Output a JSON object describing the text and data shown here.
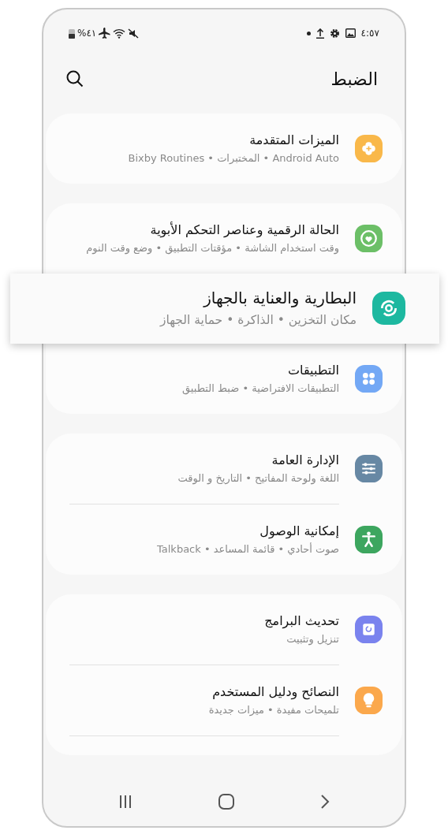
{
  "status_bar": {
    "time": "٤:٥٧",
    "battery": "%٤١"
  },
  "header": {
    "title": "الضبط"
  },
  "groups": [
    {
      "items": [
        {
          "title": "الميزات المتقدمة",
          "subtitle": "Android Auto • المختبرات • Bixby Routines",
          "color": "#f9b84a",
          "highlighted": false
        }
      ]
    },
    {
      "items": [
        {
          "title": "الحالة الرقمية وعناصر التحكم الأبوية",
          "subtitle": "وقت استخدام الشاشة • مؤقتات التطبيق • وضع وقت النوم",
          "color": "#6cbf67",
          "highlighted": false
        },
        {
          "title": "البطارية والعناية بالجهاز",
          "subtitle": "مكان التخزين • الذاكرة • حماية الجهاز",
          "color": "#1db8a0",
          "highlighted": true
        },
        {
          "title": "التطبيقات",
          "subtitle": "التطبيقات الافتراضية • ضبط التطبيق",
          "color": "#73a8f5",
          "highlighted": false
        }
      ]
    },
    {
      "items": [
        {
          "title": "الإدارة العامة",
          "subtitle": "اللغة ولوحة المفاتيح • التاريخ و الوقت",
          "color": "#6788a4",
          "highlighted": false
        },
        {
          "title": "إمكانية الوصول",
          "subtitle": "صوت أحادي • قائمة المساعد • Talkback",
          "color": "#3da65f",
          "highlighted": false
        }
      ]
    },
    {
      "items": [
        {
          "title": "تحديث البرامج",
          "subtitle": "تنزيل وتثبيت",
          "color": "#7a83ee",
          "highlighted": false
        },
        {
          "title": "النصائح ودليل المستخدم",
          "subtitle": "تلميحات مفيدة • ميزات جديدة",
          "color": "#fba84c",
          "highlighted": false
        }
      ],
      "more_below": true
    }
  ]
}
